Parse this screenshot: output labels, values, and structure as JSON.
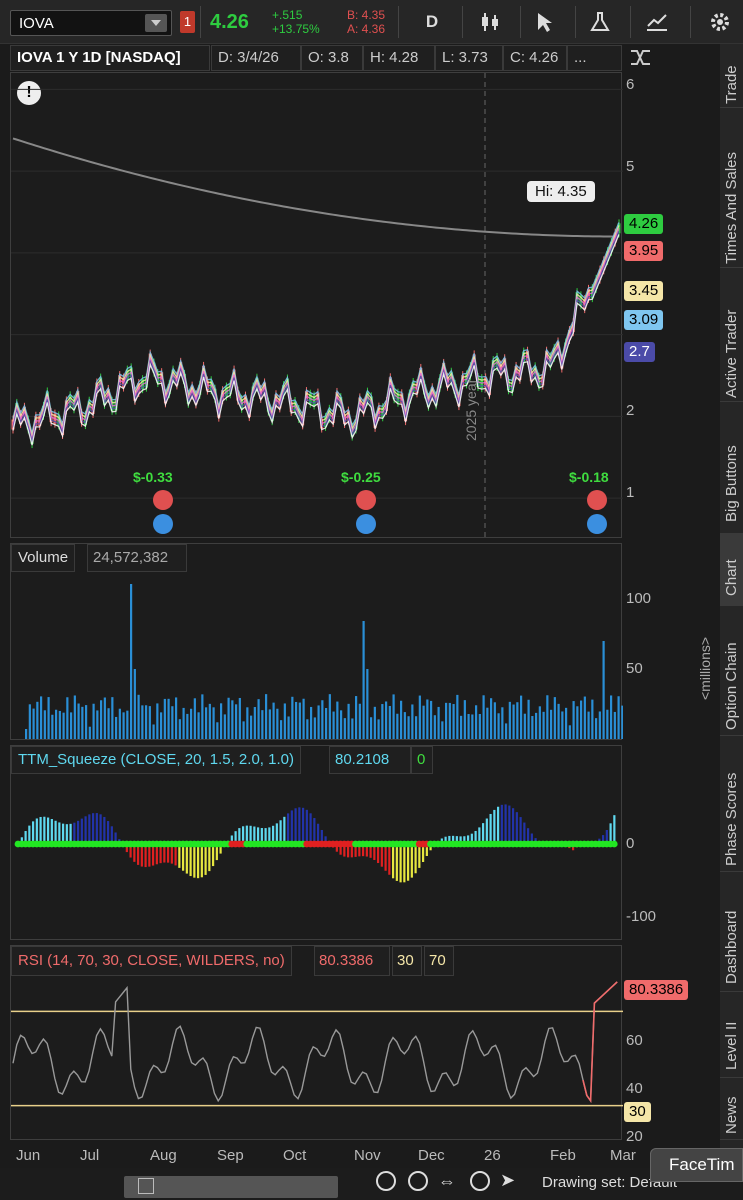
{
  "toolbar": {
    "symbol": "IOVA",
    "alert_badge": "1",
    "last": "4.26",
    "change": "+.515",
    "change_pct": "+13.75%",
    "bid": "B: 4.35",
    "ask": "A: 4.36",
    "period_button": "D"
  },
  "chart_header": {
    "title": "IOVA 1 Y 1D [NASDAQ]",
    "date": "D: 3/4/26",
    "open": "O: 3.8",
    "high": "H: 4.28",
    "low": "L: 3.73",
    "close": "C: 4.26",
    "more": "..."
  },
  "price_panel": {
    "y_ticks": [
      "6",
      "5",
      "3",
      "2",
      "1"
    ],
    "hi_callout": "Hi: 4.35",
    "year_label": "2025 year",
    "earnings": [
      "$-0.33",
      "$-0.25",
      "$-0.18"
    ],
    "price_labels": [
      {
        "value": "4.26",
        "color": "#2ecc40"
      },
      {
        "value": "3.95",
        "color": "#f06b6b"
      },
      {
        "value": "3.45",
        "color": "#f5e6a8"
      },
      {
        "value": "3.09",
        "color": "#7fc6f0"
      },
      {
        "value": "2.7",
        "color": "#4b4ba8"
      }
    ]
  },
  "volume_panel": {
    "title": "Volume",
    "value": "24,572,382",
    "y_ticks": [
      "100",
      "50"
    ],
    "unit": "<millions>"
  },
  "ttm_panel": {
    "title": "TTM_Squeeze (CLOSE, 20, 1.5, 2.0, 1.0)",
    "value": "80.2108",
    "value2": "0",
    "y_ticks": [
      "0",
      "-100"
    ]
  },
  "rsi_panel": {
    "title": "RSI (14, 70, 30, CLOSE, WILDERS, no)",
    "value": "80.3386",
    "ob": "30",
    "os": "70",
    "y_ticks": [
      "60",
      "40",
      "20"
    ],
    "last_label": "80.3386",
    "level_label": "30"
  },
  "x_axis": [
    "Jun",
    "Jul",
    "Aug",
    "Sep",
    "Oct",
    "Nov",
    "Dec",
    "26",
    "Feb",
    "Mar"
  ],
  "right_tabs": [
    "Trade",
    "Times And Sales",
    "Active Trader",
    "Big Buttons",
    "Chart",
    "Option Chain",
    "Phase Scores",
    "Dashboard",
    "Level II",
    "News"
  ],
  "bottom": {
    "drawing_set": "Drawing set: Default",
    "facetime": "FaceTim"
  },
  "chart_data": {
    "type": "line",
    "title": "IOVA 1 Y 1D [NASDAQ]",
    "x": [
      "Jun",
      "Jul",
      "Aug",
      "Sep",
      "Oct",
      "Nov",
      "Dec",
      "26",
      "Feb",
      "Mar"
    ],
    "series": [
      {
        "name": "IOVA",
        "values": [
          1.9,
          2.1,
          2.5,
          2.3,
          2.2,
          2.0,
          2.3,
          2.5,
          2.6,
          4.26
        ]
      }
    ],
    "ylim": [
      0.5,
      6.2
    ]
  }
}
